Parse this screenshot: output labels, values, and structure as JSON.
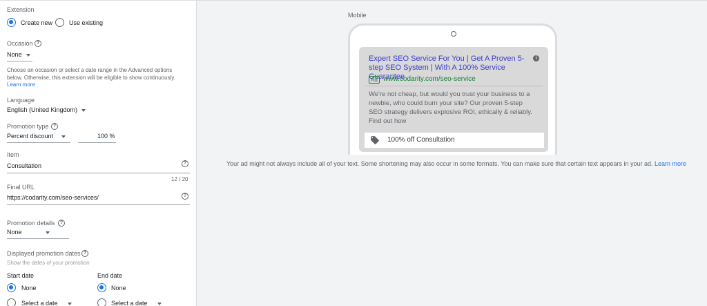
{
  "extension": {
    "heading": "Extension",
    "create_new": "Create new",
    "use_existing": "Use existing"
  },
  "occasion": {
    "label": "Occasion",
    "value": "None",
    "help": "Choose an occasion or select a date range in the Advanced options below. Otherwise, this extension will be eligible to show continuously.",
    "learn_more": "Learn more"
  },
  "language": {
    "label": "Language",
    "value": "English (United Kingdom)"
  },
  "promotion_type": {
    "label": "Promotion type",
    "value": "Percent discount",
    "percent": "100 %"
  },
  "item": {
    "label": "Item",
    "value": "Consultation",
    "counter": "12 / 20"
  },
  "final_url": {
    "label": "Final URL",
    "value": "https://codarity.com/seo-services/"
  },
  "promotion_details": {
    "label": "Promotion details",
    "value": "None"
  },
  "promotion_dates": {
    "label": "Displayed promotion dates",
    "sub": "Show the dates of your promotion",
    "start_label": "Start date",
    "end_label": "End date",
    "none": "None",
    "select_date": "Select a date"
  },
  "preview": {
    "mode_label": "Mobile",
    "ad_title": "Expert SEO Service For You | Get A Proven 5-step SEO System | With A 100% Service Guarantee",
    "ad_badge": "Ad",
    "ad_url": "www.codarity.com/seo-service",
    "ad_description": "We're not cheap, but would you trust your business to a newbie, who could burn your site? Our proven 5-step SEO strategy delivers explosive ROI, ethically & reliably. Find out how",
    "promo_text": "100% off Consultation",
    "disclaimer": "Your ad might not always include all of your text. Some shortening may also occur in some formats. You can make sure that certain text appears in your ad.",
    "disclaimer_link": "Learn more"
  },
  "colors": {
    "accent": "#1a73e8",
    "ad_green": "#188038",
    "ad_title": "#3c3ccc"
  }
}
